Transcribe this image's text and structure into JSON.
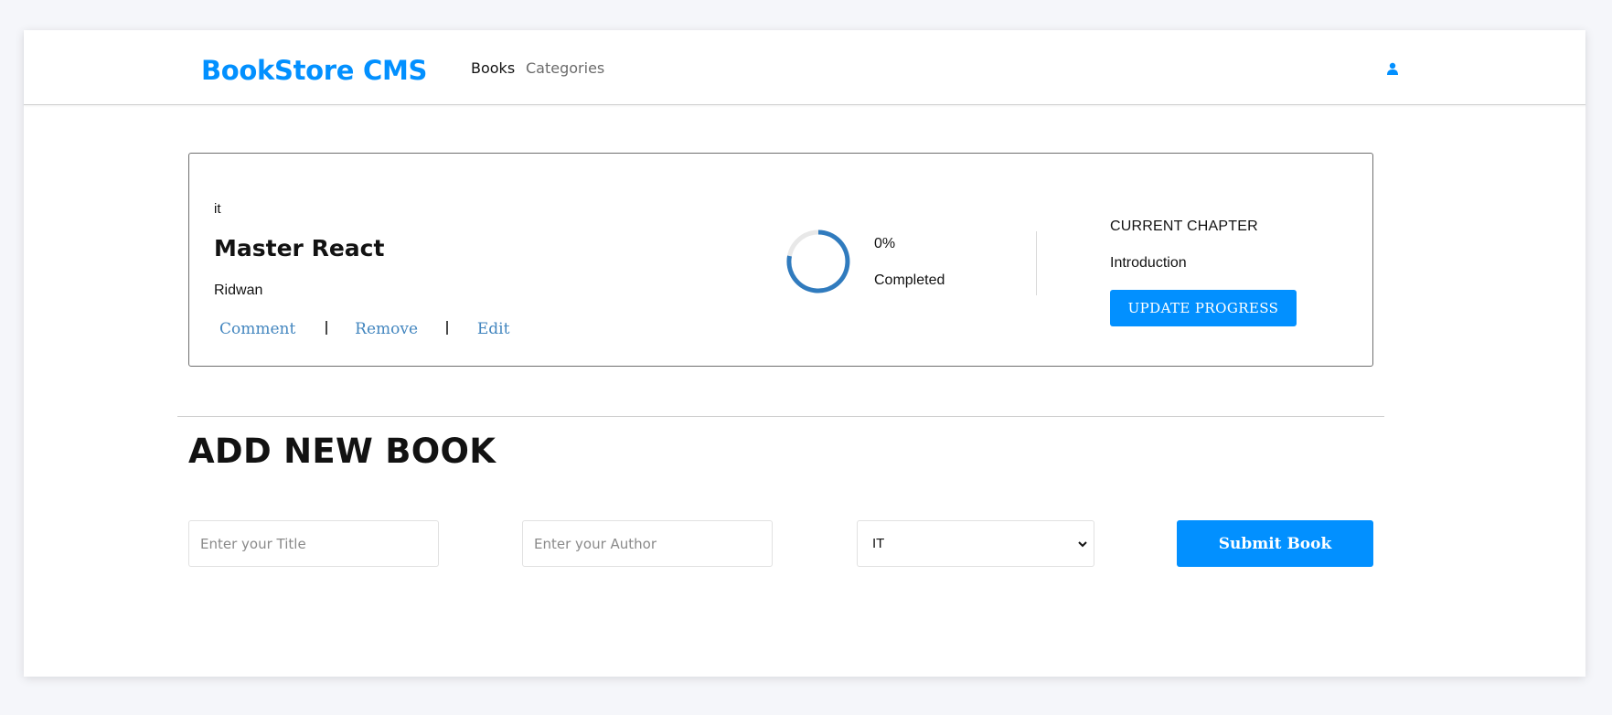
{
  "header": {
    "brand": "BookStore CMS",
    "nav": [
      {
        "label": "Books",
        "active": true
      },
      {
        "label": "Categories",
        "active": false
      }
    ],
    "user_icon": "user-icon",
    "accent_color": "#0290ff"
  },
  "book": {
    "genre": "it",
    "title": "Master React",
    "author": "Ridwan",
    "actions": [
      "Comment",
      "Remove",
      "Edit"
    ],
    "progress_percent": 0,
    "progress_label": "0%",
    "completed_label": "Completed",
    "current_chapter_label": "CURRENT CHAPTER",
    "current_chapter": "Introduction",
    "update_button": "UPDATE PROGRESS"
  },
  "add_form": {
    "heading": "ADD NEW BOOK",
    "title_placeholder": "Enter your Title",
    "author_placeholder": "Enter your Author",
    "category_selected": "IT",
    "submit_label": "Submit Book"
  }
}
